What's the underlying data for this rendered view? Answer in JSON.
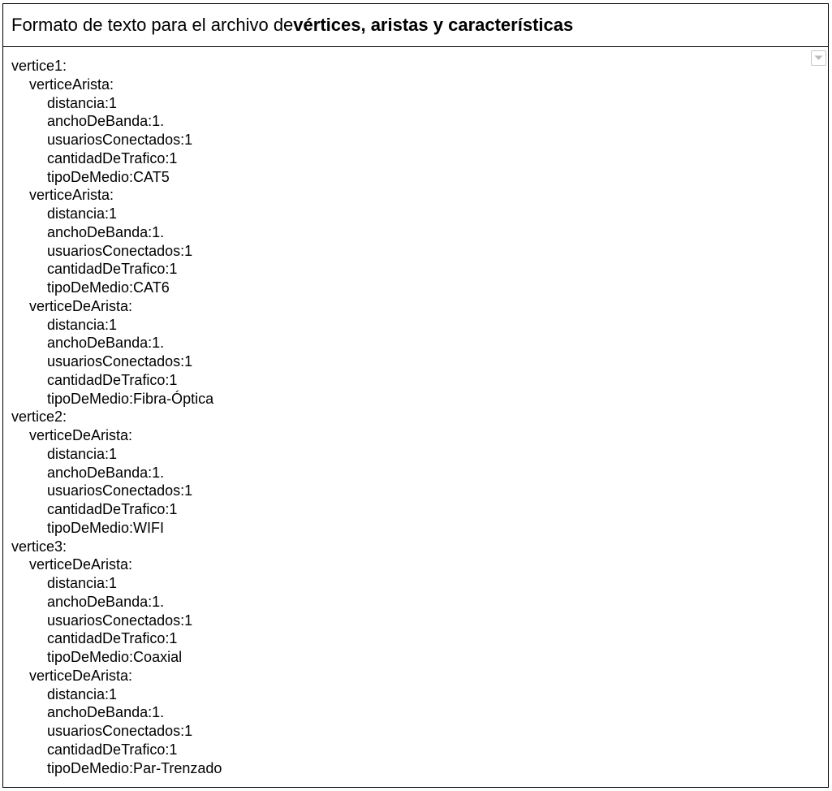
{
  "header": {
    "title_prefix": "Formato de texto para el archivo de ",
    "title_bold": "vértices, aristas y características"
  },
  "dropdown": {
    "icon": "chevron-down-icon",
    "color": "#bbbbbb"
  },
  "lines": [
    {
      "level": 0,
      "text": "vertice1:"
    },
    {
      "level": 1,
      "text": "verticeArista:"
    },
    {
      "level": 2,
      "text": "distancia:1"
    },
    {
      "level": 2,
      "text": "anchoDeBanda:1."
    },
    {
      "level": 2,
      "text": "usuariosConectados:1"
    },
    {
      "level": 2,
      "text": "cantidadDeTrafico:1"
    },
    {
      "level": 2,
      "text": "tipoDeMedio:CAT5"
    },
    {
      "level": 1,
      "text": "verticeArista:"
    },
    {
      "level": 2,
      "text": "distancia:1"
    },
    {
      "level": 2,
      "text": "anchoDeBanda:1."
    },
    {
      "level": 2,
      "text": "usuariosConectados:1"
    },
    {
      "level": 2,
      "text": "cantidadDeTrafico:1"
    },
    {
      "level": 2,
      "text": "tipoDeMedio:CAT6"
    },
    {
      "level": 1,
      "text": "verticeDeArista:"
    },
    {
      "level": 2,
      "text": "distancia:1"
    },
    {
      "level": 2,
      "text": "anchoDeBanda:1."
    },
    {
      "level": 2,
      "text": "usuariosConectados:1"
    },
    {
      "level": 2,
      "text": "cantidadDeTrafico:1"
    },
    {
      "level": 2,
      "text": "tipoDeMedio:Fibra-Óptica"
    },
    {
      "level": 0,
      "text": "vertice2:"
    },
    {
      "level": 1,
      "text": "verticeDeArista:"
    },
    {
      "level": 2,
      "text": "distancia:1"
    },
    {
      "level": 2,
      "text": "anchoDeBanda:1."
    },
    {
      "level": 2,
      "text": "usuariosConectados:1"
    },
    {
      "level": 2,
      "text": "cantidadDeTrafico:1"
    },
    {
      "level": 2,
      "text": "tipoDeMedio:WIFI"
    },
    {
      "level": 0,
      "text": "vertice3:"
    },
    {
      "level": 1,
      "text": "verticeDeArista:"
    },
    {
      "level": 2,
      "text": "distancia:1"
    },
    {
      "level": 2,
      "text": "anchoDeBanda:1."
    },
    {
      "level": 2,
      "text": "usuariosConectados:1"
    },
    {
      "level": 2,
      "text": "cantidadDeTrafico:1"
    },
    {
      "level": 2,
      "text": "tipoDeMedio:Coaxial"
    },
    {
      "level": 1,
      "text": "verticeDeArista:"
    },
    {
      "level": 2,
      "text": "distancia:1"
    },
    {
      "level": 2,
      "text": "anchoDeBanda:1."
    },
    {
      "level": 2,
      "text": "usuariosConectados:1"
    },
    {
      "level": 2,
      "text": "cantidadDeTrafico:1"
    },
    {
      "level": 2,
      "text": "tipoDeMedio:Par-Trenzado"
    }
  ]
}
